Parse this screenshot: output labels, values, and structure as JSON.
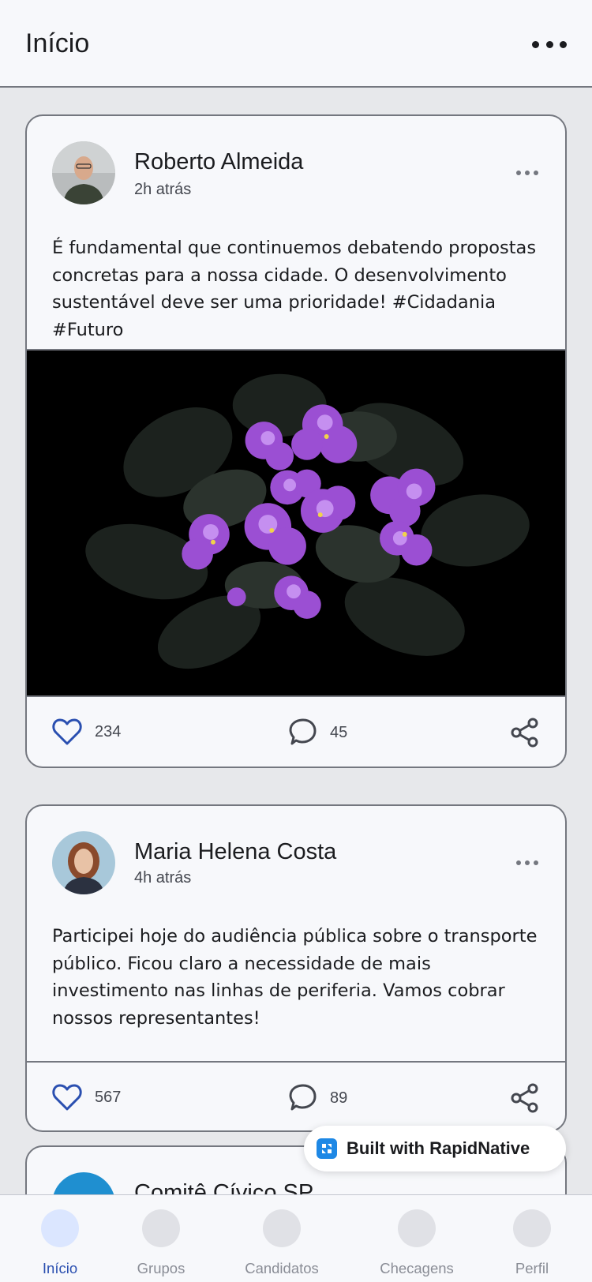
{
  "header": {
    "title": "Início"
  },
  "posts": [
    {
      "author": "Roberto Almeida",
      "time": "2h atrás",
      "text": "É fundamental que continuemos debatendo propostas concretas para a nossa cidade. O desenvolvimento sustentável deve ser uma prioridade!    #Cidadania #Futuro",
      "likes": "234",
      "comments": "45"
    },
    {
      "author": "Maria Helena Costa",
      "time": "4h atrás",
      "text": "Participei hoje do audiência pública sobre o transporte público. Ficou claro a necessidade de mais investimento nas linhas de periferia. Vamos cobrar nossos representantes!",
      "likes": "567",
      "comments": "89"
    },
    {
      "author": "Comitê Cívico SP"
    }
  ],
  "badge": {
    "label": "Built with RapidNative"
  },
  "nav": {
    "items": [
      {
        "label": "Início"
      },
      {
        "label": "Grupos"
      },
      {
        "label": "Candidatos"
      },
      {
        "label": "Checagens"
      },
      {
        "label": "Perfil"
      }
    ]
  },
  "colors": {
    "accent": "#2a4fb0",
    "like_icon": "#2a4fb0",
    "border": "#74777f",
    "card_bg": "#f7f8fb",
    "page_bg": "#e7e8eb"
  },
  "icons": [
    "more-horizontal-icon",
    "heart-icon",
    "comment-icon",
    "share-icon",
    "rapidnative-logo-icon"
  ]
}
